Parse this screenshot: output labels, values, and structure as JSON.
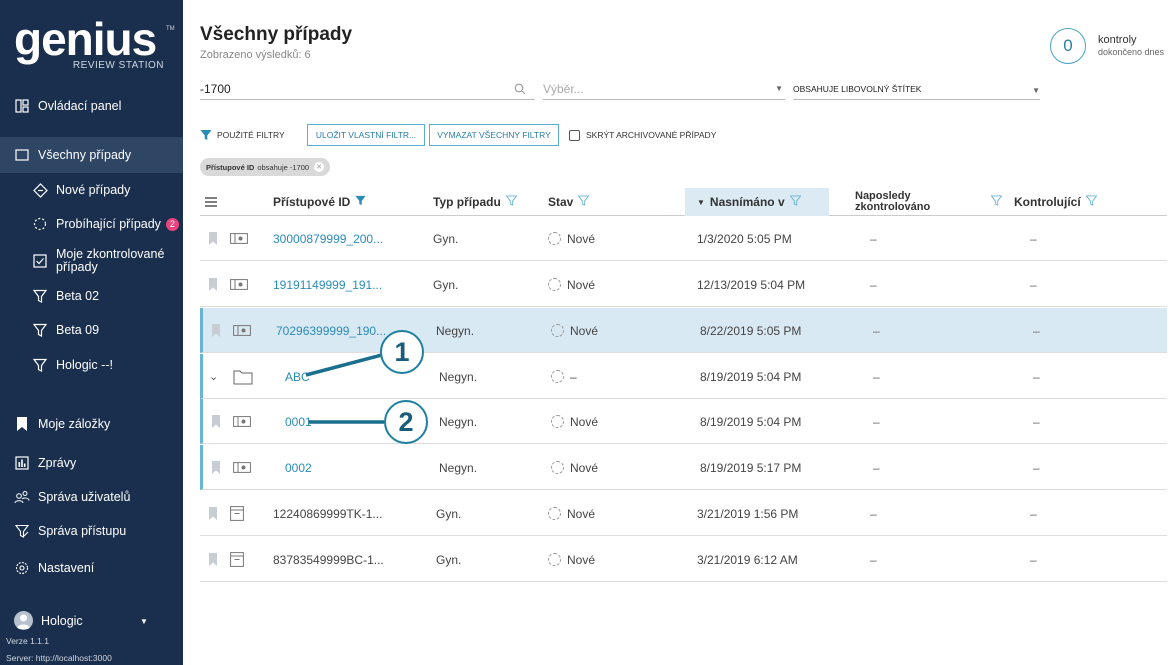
{
  "brand": {
    "name": "genius",
    "tm": "TM",
    "subtitle": "REVIEW STATION"
  },
  "sidebar": {
    "items": [
      {
        "label": "Ovládací panel",
        "icon": "dashboard-icon"
      },
      {
        "label": "Všechny případy",
        "icon": "folder-icon"
      },
      {
        "label": "Nové případy",
        "icon": "new-case-icon"
      },
      {
        "label": "Probíhající případy",
        "icon": "in-progress-icon",
        "badge": "2"
      },
      {
        "label_line1": "Moje zkontrolované",
        "label_line2": "případy",
        "icon": "checked-box-icon"
      },
      {
        "label": "Beta 02",
        "icon": "filter-icon"
      },
      {
        "label": "Beta 09",
        "icon": "filter-icon"
      },
      {
        "label": "Hologic --!",
        "icon": "filter-icon"
      },
      {
        "label": "Moje záložky",
        "icon": "bookmark-icon"
      },
      {
        "label": "Zprávy",
        "icon": "reports-icon"
      },
      {
        "label": "Správa uživatelů",
        "icon": "users-icon"
      },
      {
        "label": "Správa přístupu",
        "icon": "access-icon"
      },
      {
        "label": "Nastavení",
        "icon": "gear-icon"
      }
    ],
    "user": "Hologic",
    "version": "Verze 1.1.1",
    "server": "Server: http://localhost:3000"
  },
  "header": {
    "title": "Všechny případy",
    "subtitle": "Zobrazeno výsledků: 6",
    "counter_value": "0",
    "counter_label1": "kontroly",
    "counter_label2": "dokončeno dnes"
  },
  "search": {
    "value": "-1700"
  },
  "selects": {
    "select1_placeholder": "Výběr...",
    "select2_value": "OBSAHUJE LIBOVOLNÝ ŠTÍTEK"
  },
  "filters": {
    "applied_label": "POUŽITÉ FILTRY",
    "save_label": "ULOŽIT VLASTNÍ FILTR...",
    "clear_label": "VYMAZAT VŠECHNY FILTRY",
    "hide_archived_label": "SKRÝT ARCHIVOVANÉ PŘÍPADY",
    "chip_bold": "Přístupové ID",
    "chip_rest": "obsahuje -1700"
  },
  "table": {
    "headers": {
      "access_id": "Přístupové ID",
      "case_type": "Typ případu",
      "status": "Stav",
      "captured": "Nasnímáno v",
      "last_reviewed_1": "Naposledy",
      "last_reviewed_2": "zkontrolováno",
      "reviewers": "Kontrolující"
    },
    "rows": [
      {
        "id": "30000879999_200...",
        "type": "Gyn.",
        "status": "Nové",
        "captured": "1/3/2020 5:05 PM",
        "last": "–",
        "rev": "–"
      },
      {
        "id": "19191149999_191...",
        "type": "Gyn.",
        "status": "Nové",
        "captured": "12/13/2019 5:04 PM",
        "last": "–",
        "rev": "–"
      },
      {
        "id": "70296399999_190...",
        "type": "Negyn.",
        "status": "Nové",
        "captured": "8/22/2019 5:05 PM",
        "last": "–",
        "rev": "–"
      },
      {
        "id": "ABC",
        "type": "Negyn.",
        "status": "–",
        "captured": "8/19/2019 5:04 PM",
        "last": "–",
        "rev": "–"
      },
      {
        "id": "0001",
        "type": "Negyn.",
        "status": "Nové",
        "captured": "8/19/2019 5:04 PM",
        "last": "–",
        "rev": "–"
      },
      {
        "id": "0002",
        "type": "Negyn.",
        "status": "Nové",
        "captured": "8/19/2019 5:17 PM",
        "last": "–",
        "rev": "–"
      },
      {
        "id": "12240869999TK-1...",
        "type": "Gyn.",
        "status": "Nové",
        "captured": "3/21/2019 1:56 PM",
        "last": "–",
        "rev": "–"
      },
      {
        "id": "83783549999BC-1...",
        "type": "Gyn.",
        "status": "Nové",
        "captured": "3/21/2019 6:12 AM",
        "last": "–",
        "rev": "–"
      }
    ]
  },
  "callouts": [
    "1",
    "2"
  ],
  "colors": {
    "sidebar": "#1a2f4d",
    "accent": "#2a8bb7",
    "badge": "#e8437b",
    "highlight_row": "#d9e9f3"
  }
}
